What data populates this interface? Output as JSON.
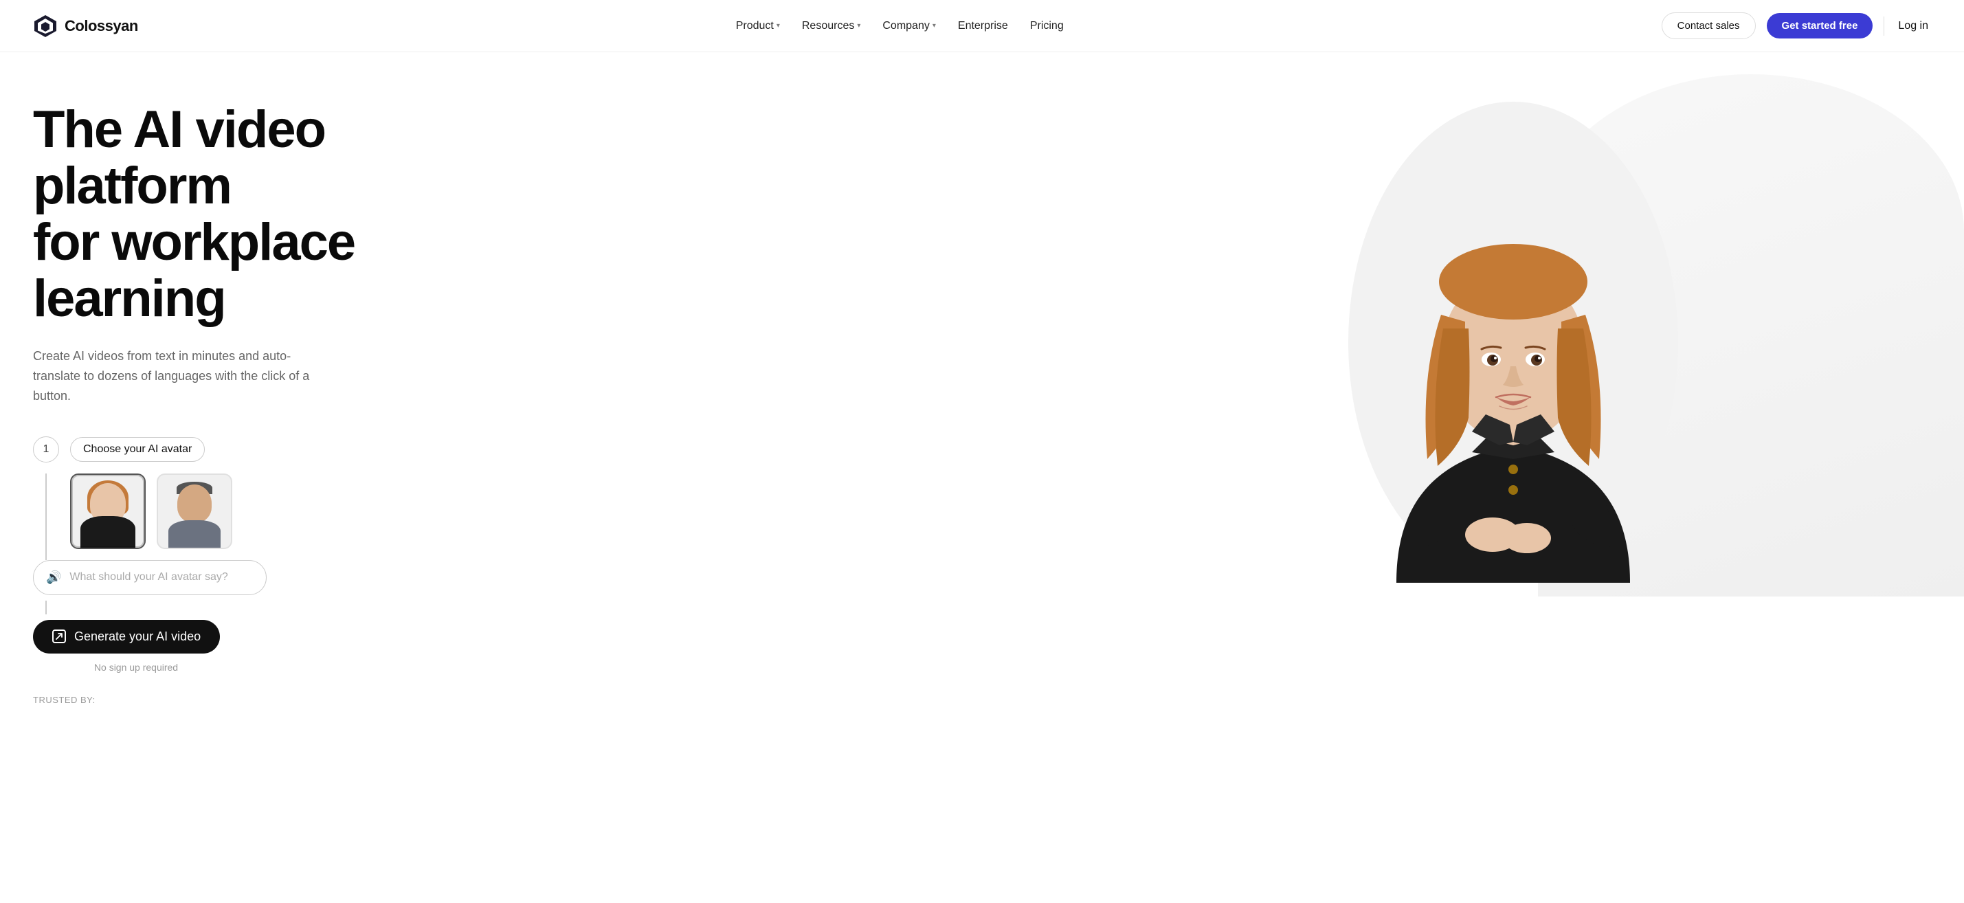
{
  "brand": {
    "name": "Colossyan",
    "logo_text": "Colossyan"
  },
  "nav": {
    "links": [
      {
        "label": "Product",
        "has_dropdown": true
      },
      {
        "label": "Resources",
        "has_dropdown": true
      },
      {
        "label": "Company",
        "has_dropdown": true
      },
      {
        "label": "Enterprise",
        "has_dropdown": false
      },
      {
        "label": "Pricing",
        "has_dropdown": false
      }
    ],
    "contact_sales": "Contact sales",
    "get_started": "Get started free",
    "login": "Log in"
  },
  "hero": {
    "title_line1": "The AI video platform",
    "title_line2": "for workplace learning",
    "subtitle": "Create AI videos from text in minutes and auto-translate to dozens of languages with the click of a button.",
    "step1": {
      "number": "1",
      "label": "Choose your AI avatar"
    },
    "step2": {
      "placeholder": "What should your AI avatar say?"
    },
    "step3": {
      "label": "Generate your AI video"
    },
    "no_signup": "No sign up required",
    "trusted_by": "TRUSTED BY:"
  },
  "colors": {
    "accent_blue": "#3b3bd4",
    "dark": "#111111",
    "light_gray": "#f5f5f5",
    "border": "#cccccc"
  }
}
